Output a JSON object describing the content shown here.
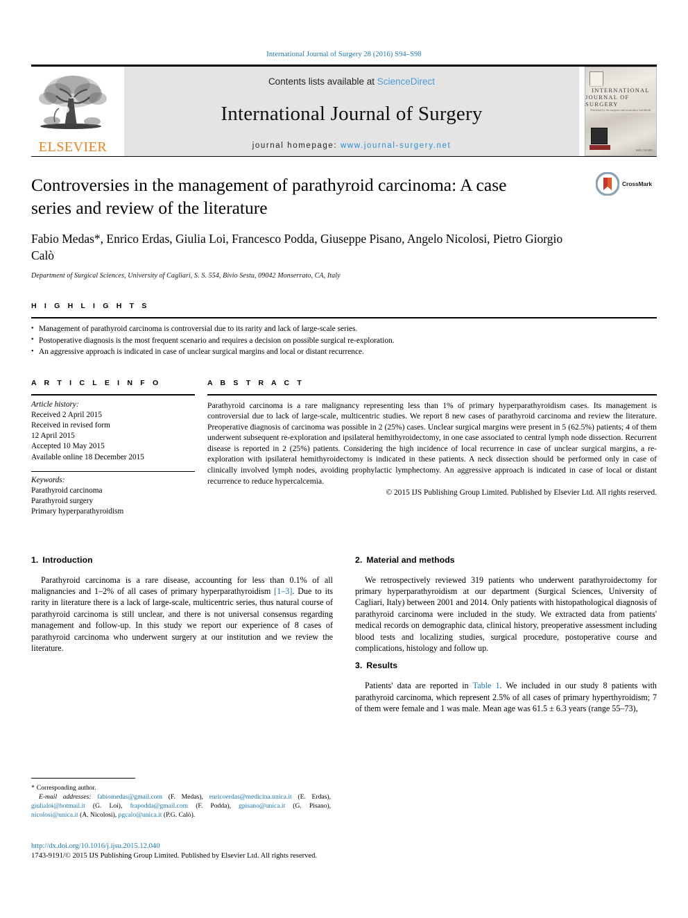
{
  "running_head": "International Journal of Surgery 28 (2016) S94–S98",
  "masthead": {
    "elsevier_word": "ELSEVIER",
    "contents_prefix": "Contents lists available at ",
    "sciencedirect": "ScienceDirect",
    "journal_title": "International Journal of Surgery",
    "homepage_prefix": "journal homepage: ",
    "homepage_url": "www.journal-surgery.net",
    "cover": {
      "line1": "INTERNATIONAL",
      "line2": "JOURNAL OF SURGERY",
      "subtitle": "Published by the surgeons and researchers worldwide",
      "issn": "ISSN 1743-9191"
    },
    "accent_link_color": "#4a9dd6",
    "elsevier_orange": "#f08019"
  },
  "title": "Controversies in the management of parathyroid carcinoma: A case series and review of the literature",
  "authors": "Fabio Medas*, Enrico Erdas, Giulia Loi, Francesco Podda, Giuseppe Pisano, Angelo Nicolosi, Pietro Giorgio Calò",
  "affiliation": "Department of Surgical Sciences, University of Cagliari, S. S. 554, Bivio Sestu, 09042 Monserrato, CA, Italy",
  "crossmark": {
    "label": "CrossMark"
  },
  "highlights": {
    "heading": "H I G H L I G H T S",
    "items": [
      "Management of parathyroid carcinoma is controversial due to its rarity and lack of large-scale series.",
      "Postoperative diagnosis is the most frequent scenario and requires a decision on possible surgical re-exploration.",
      "An aggressive approach is indicated in case of unclear surgical margins and local or distant recurrence."
    ]
  },
  "article_info": {
    "heading": "A R T I C L E  I N F O",
    "history_label": "Article history:",
    "history": [
      "Received 2 April 2015",
      "Received in revised form",
      "12 April 2015",
      "Accepted 10 May 2015",
      "Available online 18 December 2015"
    ],
    "keywords_label": "Keywords:",
    "keywords": [
      "Parathyroid carcinoma",
      "Parathyroid surgery",
      "Primary hyperparathyroidism"
    ]
  },
  "abstract": {
    "heading": "A B S T R A C T",
    "text": "Parathyroid carcinoma is a rare malignancy representing less than 1% of primary hyperparathyroidism cases. Its management is controversial due to lack of large-scale, multicentric studies. We report 8 new cases of parathyroid carcinoma and review the literature. Preoperative diagnosis of carcinoma was possible in 2 (25%) cases. Unclear surgical margins were present in 5 (62.5%) patients; 4 of them underwent subsequent re-exploration and ipsilateral hemithyroidectomy, in one case associated to central lymph node dissection. Recurrent disease is reported in 2 (25%) patients. Considering the high incidence of local recurrence in case of unclear surgical margins, a re-exploration with ipsilateral hemithyroidectomy is indicated in these patients. A neck dissection should be performed only in case of clinically involved lymph nodes, avoiding prophylactic lymphectomy. An aggressive approach is indicated in case of local or distant recurrence to reduce hypercalcemia.",
    "copyright": "© 2015 IJS Publishing Group Limited. Published by Elsevier Ltd. All rights reserved."
  },
  "sections": {
    "introduction": {
      "number": "1.",
      "title": "Introduction",
      "paragraph_a": "Parathyroid carcinoma is a rare disease, accounting for less than 0.1% of all malignancies and 1–2% of all cases of primary hyperparathyroidism ",
      "citation": "[1–3]",
      "paragraph_b": ". Due to its rarity in literature there is a lack of large-scale, multicentric series, thus natural course of parathyroid carcinoma is still unclear, and there is not universal consensus regarding management and follow-up. In this study we report our experience of 8 cases of parathyroid carcinoma who underwent surgery at our institution and we review the literature."
    },
    "material_methods": {
      "number": "2.",
      "title": "Material and methods",
      "paragraph": "We retrospectively reviewed 319 patients who underwent parathyroidectomy for primary hyperparathyroidism at our department (Surgical Sciences, University of Cagliari, Italy) between 2001 and 2014. Only patients with histopathological diagnosis of parathyroid carcinoma were included in the study. We extracted data from patients' medical records on demographic data, clinical history, preoperative assessment including blood tests and localizing studies, surgical procedure, postoperative course and complications, histology and follow up."
    },
    "results": {
      "number": "3.",
      "title": "Results",
      "paragraph_a": "Patients' data are reported in ",
      "table_link": "Table 1",
      "paragraph_b": ". We included in our study 8 patients with parathyroid carcinoma, which represent 2.5% of all cases of primary hyperthyroidism; 7 of them were female and 1 was male. Mean age was 61.5 ± 6.3 years (range 55–73),"
    }
  },
  "footnote": {
    "corresponding": "Corresponding author.",
    "email_label": "E-mail addresses:",
    "emails": [
      {
        "address": "fabiomedas@gmail.com",
        "name": "(F. Medas)"
      },
      {
        "address": "enricoerdas@medicina.unica.it",
        "name": "(E. Erdas)"
      },
      {
        "address": "giulialoi@hotmail.it",
        "name": "(G. Loi)"
      },
      {
        "address": "frapodda@gmail.com",
        "name": "(F. Podda)"
      },
      {
        "address": "gpisano@unica.it",
        "name": "(G. Pisano)"
      },
      {
        "address": "nicolosi@unica.it",
        "name": "(A. Nicolosi)"
      },
      {
        "address": "pgcalo@unica.it",
        "name": "(P.G. Calò)"
      }
    ]
  },
  "doi": "http://dx.doi.org/10.1016/j.ijsu.2015.12.040",
  "issn_line": "1743-9191/© 2015 IJS Publishing Group Limited. Published by Elsevier Ltd. All rights reserved."
}
